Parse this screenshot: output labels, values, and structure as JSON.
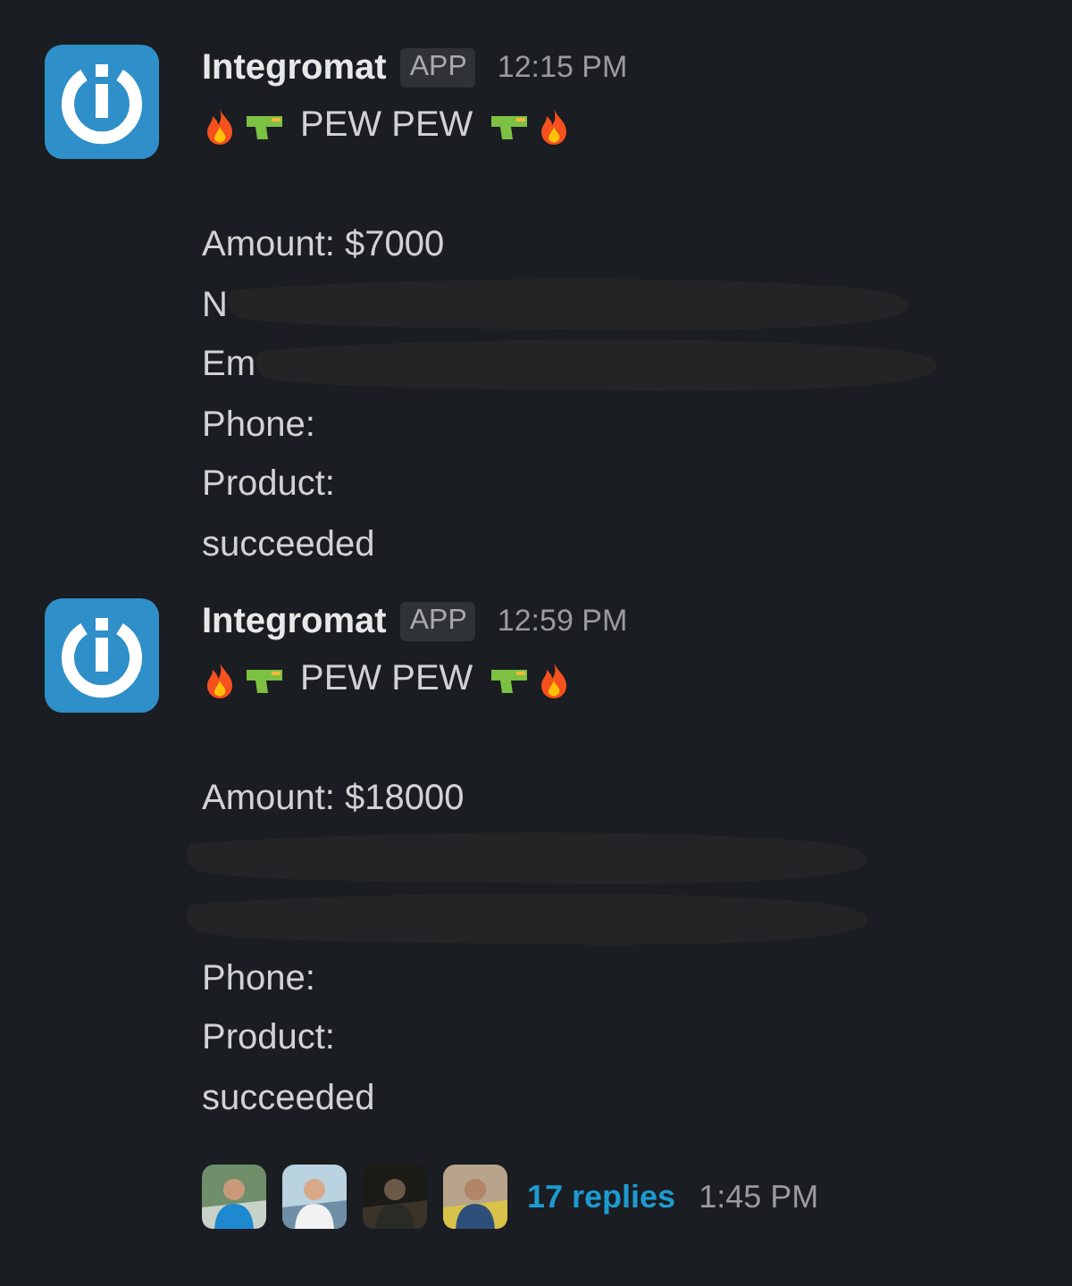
{
  "messages": [
    {
      "sender": "Integromat",
      "badge": "APP",
      "time": "12:15 PM",
      "lines": [
        {
          "kind": "emoji",
          "text": "PEW PEW"
        },
        {
          "kind": "blank"
        },
        {
          "kind": "text",
          "text": "Amount: $7000"
        },
        {
          "kind": "text",
          "text": "N",
          "covered": true
        },
        {
          "kind": "text",
          "text": "Em",
          "covered": true
        },
        {
          "kind": "text",
          "text": "Phone:"
        },
        {
          "kind": "text",
          "text": "Product:"
        },
        {
          "kind": "text",
          "text": "succeeded"
        }
      ]
    },
    {
      "sender": "Integromat",
      "badge": "APP",
      "time": "12:59 PM",
      "lines": [
        {
          "kind": "emoji",
          "text": "PEW PEW"
        },
        {
          "kind": "blank"
        },
        {
          "kind": "text",
          "text": "Amount: $18000"
        },
        {
          "kind": "text",
          "covered": true
        },
        {
          "kind": "text",
          "covered": true
        },
        {
          "kind": "text",
          "text": "Phone:"
        },
        {
          "kind": "text",
          "text": "Product:"
        },
        {
          "kind": "text",
          "text": "succeeded"
        }
      ],
      "thread": {
        "replies": "17 replies",
        "time": "1:45 PM"
      }
    }
  ]
}
